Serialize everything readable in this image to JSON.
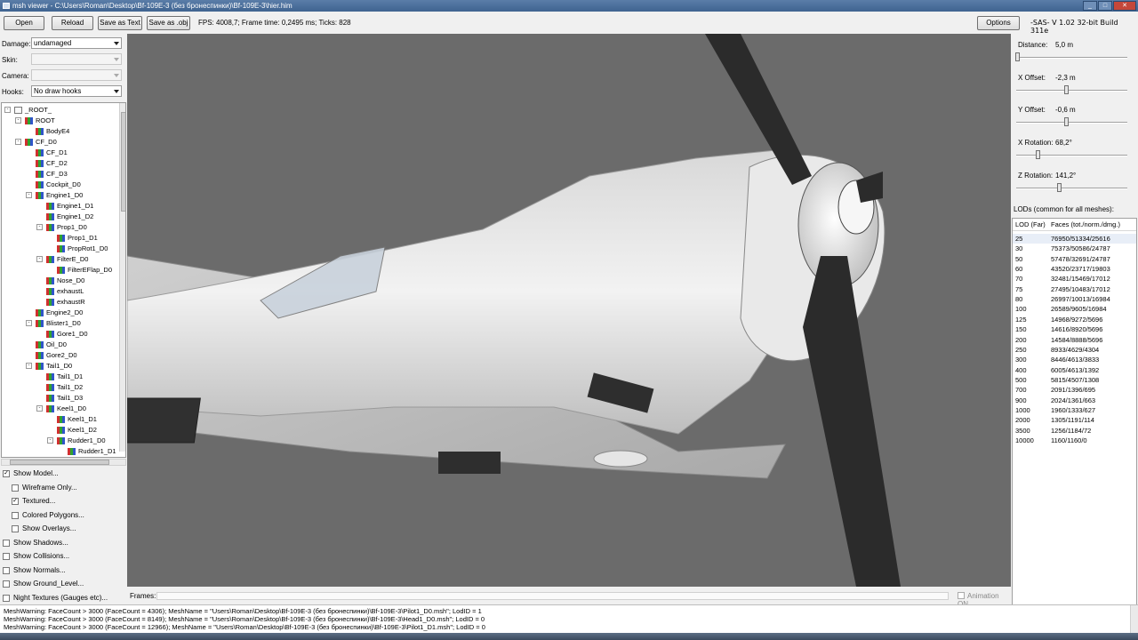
{
  "window": {
    "title": "msh viewer - C:\\Users\\Roman\\Desktop\\Bf-109E-3 (без бронеспинки)\\Bf-109E-3\\hier.him"
  },
  "toolbar": {
    "open": "Open",
    "reload": "Reload",
    "save_text": "Save as Text",
    "save_obj": "Save as .obj",
    "fps": "FPS: 4008,7; Frame time: 0,2495 ms; Ticks: 828",
    "options": "Options",
    "version": "-SAS- V 1.02  32-bit  Build 311e"
  },
  "left": {
    "damage_label": "Damage:",
    "damage_value": "undamaged",
    "skin_label": "Skin:",
    "skin_value": "",
    "camera_label": "Camera:",
    "camera_value": "",
    "hooks_label": "Hooks:",
    "hooks_value": "No draw hooks",
    "tree": [
      {
        "label": "_ROOT_",
        "depth": 0,
        "expander": "-",
        "icon": "root"
      },
      {
        "label": "ROOT",
        "depth": 1,
        "expander": "-",
        "icon": "mesh"
      },
      {
        "label": "BodyE4",
        "depth": 2,
        "expander": "",
        "icon": "mesh"
      },
      {
        "label": "CF_D0",
        "depth": 1,
        "expander": "-",
        "icon": "mesh"
      },
      {
        "label": "CF_D1",
        "depth": 2,
        "expander": "",
        "icon": "mesh"
      },
      {
        "label": "CF_D2",
        "depth": 2,
        "expander": "",
        "icon": "mesh"
      },
      {
        "label": "CF_D3",
        "depth": 2,
        "expander": "",
        "icon": "mesh"
      },
      {
        "label": "Cockpit_D0",
        "depth": 2,
        "expander": "",
        "icon": "mesh"
      },
      {
        "label": "Engine1_D0",
        "depth": 2,
        "expander": "-",
        "icon": "mesh"
      },
      {
        "label": "Engine1_D1",
        "depth": 3,
        "expander": "",
        "icon": "mesh"
      },
      {
        "label": "Engine1_D2",
        "depth": 3,
        "expander": "",
        "icon": "mesh"
      },
      {
        "label": "Prop1_D0",
        "depth": 3,
        "expander": "-",
        "icon": "mesh"
      },
      {
        "label": "Prop1_D1",
        "depth": 4,
        "expander": "",
        "icon": "mesh"
      },
      {
        "label": "PropRot1_D0",
        "depth": 4,
        "expander": "",
        "icon": "mesh"
      },
      {
        "label": "FilterE_D0",
        "depth": 3,
        "expander": "-",
        "icon": "mesh"
      },
      {
        "label": "FilterEFlap_D0",
        "depth": 4,
        "expander": "",
        "icon": "mesh"
      },
      {
        "label": "Nose_D0",
        "depth": 3,
        "expander": "",
        "icon": "mesh"
      },
      {
        "label": "exhaustL",
        "depth": 3,
        "expander": "",
        "icon": "mesh"
      },
      {
        "label": "exhaustR",
        "depth": 3,
        "expander": "",
        "icon": "mesh"
      },
      {
        "label": "Engine2_D0",
        "depth": 2,
        "expander": "",
        "icon": "mesh"
      },
      {
        "label": "Blister1_D0",
        "depth": 2,
        "expander": "-",
        "icon": "mesh"
      },
      {
        "label": "Gore1_D0",
        "depth": 3,
        "expander": "",
        "icon": "mesh"
      },
      {
        "label": "Oil_D0",
        "depth": 2,
        "expander": "",
        "icon": "mesh"
      },
      {
        "label": "Gore2_D0",
        "depth": 2,
        "expander": "",
        "icon": "mesh"
      },
      {
        "label": "Tail1_D0",
        "depth": 2,
        "expander": "-",
        "icon": "mesh"
      },
      {
        "label": "Tail1_D1",
        "depth": 3,
        "expander": "",
        "icon": "mesh"
      },
      {
        "label": "Tail1_D2",
        "depth": 3,
        "expander": "",
        "icon": "mesh"
      },
      {
        "label": "Tail1_D3",
        "depth": 3,
        "expander": "",
        "icon": "mesh"
      },
      {
        "label": "Keel1_D0",
        "depth": 3,
        "expander": "-",
        "icon": "mesh"
      },
      {
        "label": "Keel1_D1",
        "depth": 4,
        "expander": "",
        "icon": "mesh"
      },
      {
        "label": "Keel1_D2",
        "depth": 4,
        "expander": "",
        "icon": "mesh"
      },
      {
        "label": "Rudder1_D0",
        "depth": 4,
        "expander": "-",
        "icon": "mesh"
      },
      {
        "label": "Rudder1_D1",
        "depth": 5,
        "expander": "",
        "icon": "mesh"
      }
    ],
    "checkboxes": [
      {
        "label": "Show Model...",
        "checked": true,
        "indent": 0
      },
      {
        "label": "Wireframe Only...",
        "checked": false,
        "indent": 1
      },
      {
        "label": "Textured...",
        "checked": true,
        "indent": 1
      },
      {
        "label": "Colored Polygons...",
        "checked": false,
        "indent": 1
      },
      {
        "label": "Show Overlays...",
        "checked": false,
        "indent": 1
      },
      {
        "label": "Show Shadows...",
        "checked": false,
        "indent": 0
      },
      {
        "label": "Show Collisions...",
        "checked": false,
        "indent": 0
      },
      {
        "label": "Show Normals...",
        "checked": false,
        "indent": 0
      },
      {
        "label": "Show Ground_Level...",
        "checked": false,
        "indent": 0
      },
      {
        "label": "Night Textures (Gauges etc)...",
        "checked": false,
        "indent": 0
      }
    ]
  },
  "right": {
    "sliders": [
      {
        "name": "Distance:",
        "value": "5,0 m",
        "level": 0.0
      },
      {
        "name": "X Offset:",
        "value": "-2,3 m",
        "level": 0.46
      },
      {
        "name": "Y Offset:",
        "value": "-0,6 m",
        "level": 0.46
      },
      {
        "name": "X Rotation:",
        "value": "68,2°",
        "level": 0.19
      },
      {
        "name": "Z Rotation:",
        "value": "141,2°",
        "level": 0.39
      }
    ],
    "lod_header": "LODs (common for all meshes):",
    "lod_col1": "LOD (Far)",
    "lod_col2": "Faces (tot./norm./dmg.)",
    "lods": [
      [
        "25",
        "76950/51334/25616"
      ],
      [
        "30",
        "75373/50586/24787"
      ],
      [
        "50",
        "57478/32691/24787"
      ],
      [
        "60",
        "43520/23717/19803"
      ],
      [
        "70",
        "32481/15469/17012"
      ],
      [
        "75",
        "27495/10483/17012"
      ],
      [
        "80",
        "26997/10013/16984"
      ],
      [
        "100",
        "26589/9605/16984"
      ],
      [
        "125",
        "14968/9272/5696"
      ],
      [
        "150",
        "14616/8920/5696"
      ],
      [
        "200",
        "14584/8888/5696"
      ],
      [
        "250",
        "8933/4629/4304"
      ],
      [
        "300",
        "8446/4613/3833"
      ],
      [
        "400",
        "6005/4613/1392"
      ],
      [
        "500",
        "5815/4507/1308"
      ],
      [
        "700",
        "2091/1396/695"
      ],
      [
        "900",
        "2024/1361/663"
      ],
      [
        "1000",
        "1960/1333/627"
      ],
      [
        "2000",
        "1305/1191/114"
      ],
      [
        "3500",
        "1256/1184/72"
      ],
      [
        "10000",
        "1160/1160/0"
      ]
    ]
  },
  "frames": {
    "label": "Frames:",
    "animation": "Animation ON"
  },
  "log": [
    "MeshWarning: FaceCount > 3000 (FaceCount = 4306); MeshName = \"Users\\Roman\\Desktop\\Bf-109E-3 (без бронеспинки)\\Bf-109E-3\\Pilot1_D0.msh\"; LodID = 1",
    "MeshWarning: FaceCount > 3000 (FaceCount = 8149); MeshName = \"Users\\Roman\\Desktop\\Bf-109E-3 (без бронеспинки)\\Bf-109E-3\\Head1_D0.msh\"; LodID = 0",
    "MeshWarning: FaceCount > 3000 (FaceCount = 12966); MeshName = \"Users\\Roman\\Desktop\\Bf-109E-3 (без бронеспинки)\\Bf-109E-3\\Pilot1_D1.msh\"; LodID = 0"
  ]
}
